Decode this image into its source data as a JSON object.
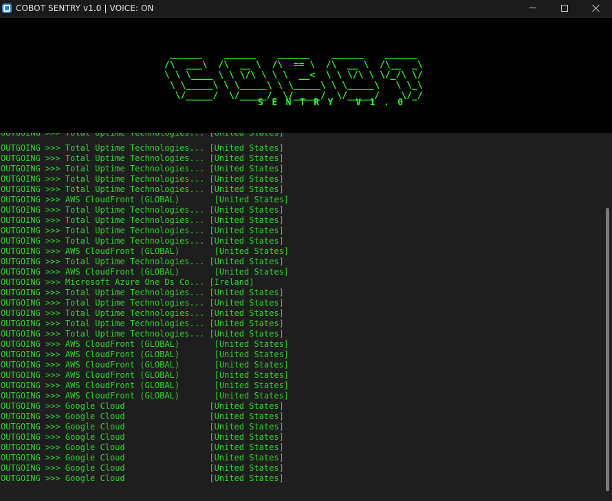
{
  "window": {
    "title": "COBOT SENTRY v1.0 | VOICE: ON",
    "icon": "app-icon"
  },
  "banner": {
    "ascii_art": " ______    ______    ______    ______    ______\n/\\  ___\\  /\\  __ \\  /\\  == \\  /\\  __ \\  /\\__  _\\\n\\ \\ \\____ \\ \\ \\/\\ \\ \\ \\  __<  \\ \\ \\/\\ \\ \\/_/\\ \\/\n \\ \\_____\\ \\ \\_____\\ \\ \\_____\\ \\ \\_____\\   \\ \\_\\\n  \\/_____/  \\/_____/  \\/_____/  \\/_____/    \\/_/",
    "subtitle": "SENTRY V1.0",
    "color": "#2bff2b"
  },
  "log": {
    "color": "#2bd82b",
    "partial_first_line": "OUTGOING >>> Total Uptime Technologies... [United States]",
    "lines": [
      "OUTGOING >>> Total Uptime Technologies... [United States]",
      "OUTGOING >>> Total Uptime Technologies... [United States]",
      "OUTGOING >>> Total Uptime Technologies... [United States]",
      "OUTGOING >>> Total Uptime Technologies... [United States]",
      "OUTGOING >>> Total Uptime Technologies... [United States]",
      "OUTGOING >>> AWS CloudFront (GLOBAL)       [United States]",
      "OUTGOING >>> Total Uptime Technologies... [United States]",
      "OUTGOING >>> Total Uptime Technologies... [United States]",
      "OUTGOING >>> Total Uptime Technologies... [United States]",
      "OUTGOING >>> Total Uptime Technologies... [United States]",
      "OUTGOING >>> AWS CloudFront (GLOBAL)       [United States]",
      "OUTGOING >>> Total Uptime Technologies... [United States]",
      "OUTGOING >>> AWS CloudFront (GLOBAL)       [United States]",
      "OUTGOING >>> Microsoft Azure One Ds Co... [Ireland]",
      "OUTGOING >>> Total Uptime Technologies... [United States]",
      "OUTGOING >>> Total Uptime Technologies... [United States]",
      "OUTGOING >>> Total Uptime Technologies... [United States]",
      "OUTGOING >>> Total Uptime Technologies... [United States]",
      "OUTGOING >>> Total Uptime Technologies... [United States]",
      "OUTGOING >>> AWS CloudFront (GLOBAL)       [United States]",
      "OUTGOING >>> AWS CloudFront (GLOBAL)       [United States]",
      "OUTGOING >>> AWS CloudFront (GLOBAL)       [United States]",
      "OUTGOING >>> AWS CloudFront (GLOBAL)       [United States]",
      "OUTGOING >>> AWS CloudFront (GLOBAL)       [United States]",
      "OUTGOING >>> AWS CloudFront (GLOBAL)       [United States]",
      "OUTGOING >>> Google Cloud                 [United States]",
      "OUTGOING >>> Google Cloud                 [United States]",
      "OUTGOING >>> Google Cloud                 [United States]",
      "OUTGOING >>> Google Cloud                 [United States]",
      "OUTGOING >>> Google Cloud                 [United States]",
      "OUTGOING >>> Google Cloud                 [United States]",
      "OUTGOING >>> Google Cloud                 [United States]",
      "OUTGOING >>> Google Cloud                 [United States]"
    ]
  }
}
